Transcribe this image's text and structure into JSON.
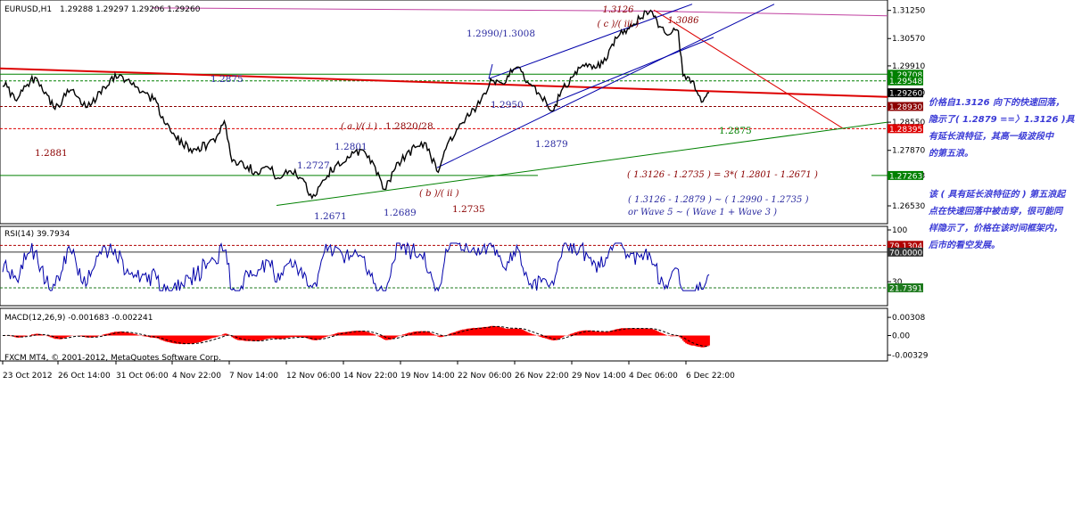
{
  "header": {
    "symbol": "EURUSD,H1",
    "ohlc": "1.29288 1.29297 1.29206 1.29260"
  },
  "rsi_header": "RSI(14) 39.7934",
  "macd_header": "MACD(12,26,9) -0.001683 -0.002241",
  "copyright": "FXCM MT4, © 2001-2012, MetaQuotes Software Corp.",
  "colors": {
    "price_line": "#000000",
    "trend_red": "#dd0000",
    "channel_blue": "#0000aa",
    "support_green": "#008000",
    "magenta": "#c040a0",
    "rsi_line": "#0000aa",
    "macd_hist": "#ff0000",
    "label_blue": "#2a2aa0",
    "label_red": "#8b0000",
    "note_blue": "#3b3bd6"
  },
  "chart_data": [
    {
      "type": "line",
      "title": "EURUSD,H1",
      "ylim": [
        1.2625,
        1.3135
      ],
      "y_ticks": [
        "1.31250",
        "1.30570",
        "1.29910",
        "1.29260",
        "1.28550",
        "1.27870",
        "1.27263",
        "1.26530"
      ],
      "price_tags": [
        "1.29708",
        "1.29548",
        "1.29260",
        "1.28930",
        "1.28395",
        "1.27263"
      ],
      "x_ticks": [
        "23 Oct 2012",
        "26 Oct 14:00",
        "31 Oct 06:00",
        "4 Nov 22:00",
        "7 Nov 14:00",
        "12 Nov 06:00",
        "14 Nov 22:00",
        "19 Nov 14:00",
        "22 Nov 06:00",
        "26 Nov 22:00",
        "29 Nov 14:00",
        "4 Dec 06:00",
        "6 Dec 22:00"
      ],
      "anchors": [
        {
          "x": 0,
          "y": 1.296
        },
        {
          "x": 8,
          "y": 1.294
        },
        {
          "x": 18,
          "y": 1.2905
        },
        {
          "x": 30,
          "y": 1.2945
        },
        {
          "x": 40,
          "y": 1.2965
        },
        {
          "x": 52,
          "y": 1.2925
        },
        {
          "x": 62,
          "y": 1.2885
        },
        {
          "x": 70,
          "y": 1.291
        },
        {
          "x": 80,
          "y": 1.2935
        },
        {
          "x": 92,
          "y": 1.2895
        },
        {
          "x": 103,
          "y": 1.29
        },
        {
          "x": 112,
          "y": 1.293
        },
        {
          "x": 124,
          "y": 1.296
        },
        {
          "x": 135,
          "y": 1.297
        },
        {
          "x": 146,
          "y": 1.295
        },
        {
          "x": 160,
          "y": 1.293
        },
        {
          "x": 172,
          "y": 1.291
        },
        {
          "x": 182,
          "y": 1.287
        },
        {
          "x": 192,
          "y": 1.283
        },
        {
          "x": 205,
          "y": 1.28
        },
        {
          "x": 218,
          "y": 1.279
        },
        {
          "x": 232,
          "y": 1.28
        },
        {
          "x": 243,
          "y": 1.282
        },
        {
          "x": 252,
          "y": 1.286
        },
        {
          "x": 260,
          "y": 1.276
        },
        {
          "x": 272,
          "y": 1.2758
        },
        {
          "x": 286,
          "y": 1.2735
        },
        {
          "x": 300,
          "y": 1.2748
        },
        {
          "x": 313,
          "y": 1.2718
        },
        {
          "x": 326,
          "y": 1.2738
        },
        {
          "x": 340,
          "y": 1.2718
        },
        {
          "x": 350,
          "y": 1.2671
        },
        {
          "x": 362,
          "y": 1.2715
        },
        {
          "x": 376,
          "y": 1.275
        },
        {
          "x": 392,
          "y": 1.277
        },
        {
          "x": 406,
          "y": 1.279
        },
        {
          "x": 418,
          "y": 1.276
        },
        {
          "x": 430,
          "y": 1.2689
        },
        {
          "x": 442,
          "y": 1.274
        },
        {
          "x": 455,
          "y": 1.2775
        },
        {
          "x": 466,
          "y": 1.2795
        },
        {
          "x": 478,
          "y": 1.2805
        },
        {
          "x": 490,
          "y": 1.2735
        },
        {
          "x": 502,
          "y": 1.2805
        },
        {
          "x": 514,
          "y": 1.284
        },
        {
          "x": 526,
          "y": 1.287
        },
        {
          "x": 538,
          "y": 1.29
        },
        {
          "x": 550,
          "y": 1.296
        },
        {
          "x": 562,
          "y": 1.295
        },
        {
          "x": 574,
          "y": 1.2975
        },
        {
          "x": 582,
          "y": 1.299
        },
        {
          "x": 592,
          "y": 1.295
        },
        {
          "x": 604,
          "y": 1.2925
        },
        {
          "x": 612,
          "y": 1.2905
        },
        {
          "x": 620,
          "y": 1.2879
        },
        {
          "x": 630,
          "y": 1.2935
        },
        {
          "x": 642,
          "y": 1.2965
        },
        {
          "x": 655,
          "y": 1.299
        },
        {
          "x": 668,
          "y": 1.2985
        },
        {
          "x": 680,
          "y": 1.3005
        },
        {
          "x": 692,
          "y": 1.306
        },
        {
          "x": 705,
          "y": 1.308
        },
        {
          "x": 718,
          "y": 1.3105
        },
        {
          "x": 730,
          "y": 1.3126
        },
        {
          "x": 740,
          "y": 1.3085
        },
        {
          "x": 750,
          "y": 1.3066
        },
        {
          "x": 760,
          "y": 1.3086
        },
        {
          "x": 766,
          "y": 1.296
        },
        {
          "x": 776,
          "y": 1.2955
        },
        {
          "x": 782,
          "y": 1.2925
        },
        {
          "x": 787,
          "y": 1.29
        },
        {
          "x": 793,
          "y": 1.2926
        }
      ],
      "annotations": [
        {
          "text": "1.3126",
          "color": "red"
        },
        {
          "text": "( c )/( iii )",
          "color": "red"
        },
        {
          "text": "1.3086",
          "color": "red"
        },
        {
          "text": "1.2990/1.3008",
          "color": "blue"
        },
        {
          "text": "1.2875",
          "color": "blue"
        },
        {
          "text": "1.2881",
          "color": "red"
        },
        {
          "text": "( a )/( i )",
          "color": "red"
        },
        {
          "text": "1.2820/28",
          "color": "red"
        },
        {
          "text": "1.2801",
          "color": "blue"
        },
        {
          "text": "1.2950",
          "color": "blue"
        },
        {
          "text": "1.2879",
          "color": "blue"
        },
        {
          "text": "1.2875",
          "color": "green"
        },
        {
          "text": "1.2727",
          "color": "blue"
        },
        {
          "text": "( b )/( ii )",
          "color": "red"
        },
        {
          "text": "1.2735",
          "color": "red"
        },
        {
          "text": "1.2689",
          "color": "blue"
        },
        {
          "text": "1.2671",
          "color": "blue"
        },
        {
          "text": "( 1.3126 - 1.2735 ) = 3*( 1.2801 - 1.2671 )",
          "color": "red"
        },
        {
          "text": "( 1.3126 - 1.2879 ) ~ ( 1.2990 - 1.2735 )",
          "color": "blue"
        },
        {
          "text": "or Wave 5 ~ ( Wave 1 + Wave 3 )",
          "color": "blue"
        }
      ]
    },
    {
      "type": "line",
      "title": "RSI(14) 39.7934",
      "ylim": [
        0,
        100
      ],
      "y_ticks": [
        "100",
        "30",
        "0"
      ],
      "levels": [
        {
          "label": "79.1304",
          "value": 79.13
        },
        {
          "label": "70.0000",
          "value": 70
        },
        {
          "label": "21.7391",
          "value": 21.74
        }
      ],
      "last_value": 39.7934
    },
    {
      "type": "bar",
      "title": "MACD(12,26,9) -0.001683 -0.002241",
      "ylim": [
        -0.004,
        0.004
      ],
      "y_ticks": [
        "0.00308",
        "0.00",
        "-0.00329"
      ],
      "main": -0.001683,
      "signal": -0.002241
    }
  ],
  "notes": [
    {
      "lines": [
        "价格自1.3126 向下的快速回落，",
        "隐示了( 1.2879 ==〉1.3126 )具",
        "有延长浪特征，其高一级波段中",
        "的第五浪。"
      ]
    },
    {
      "lines": [
        "该 ( 具有延长浪特征的 ) 第五浪起",
        "点在快速回落中被击穿，很可能同",
        "样隐示了，价格在该时间框架内，",
        "后市的看空发展。"
      ]
    }
  ]
}
